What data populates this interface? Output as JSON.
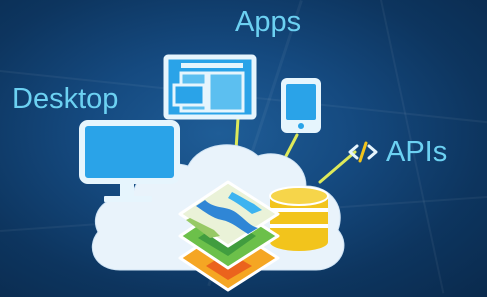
{
  "labels": {
    "apps": "Apps",
    "desktop": "Desktop",
    "apis": "APIs"
  },
  "icons": {
    "desktop": "monitor-icon",
    "apps": "browser-windows-icon",
    "mobile": "tablet-icon",
    "apis": "code-brackets-icon",
    "cloud": "cloud-icon",
    "database": "database-icon",
    "layers": "map-layers-icon"
  },
  "colors": {
    "label": "#6cd1f2",
    "icon": "#2aa3e8",
    "connector": "#dde95a",
    "cloud": "#e9f3fb",
    "database": "#f2c41c"
  }
}
